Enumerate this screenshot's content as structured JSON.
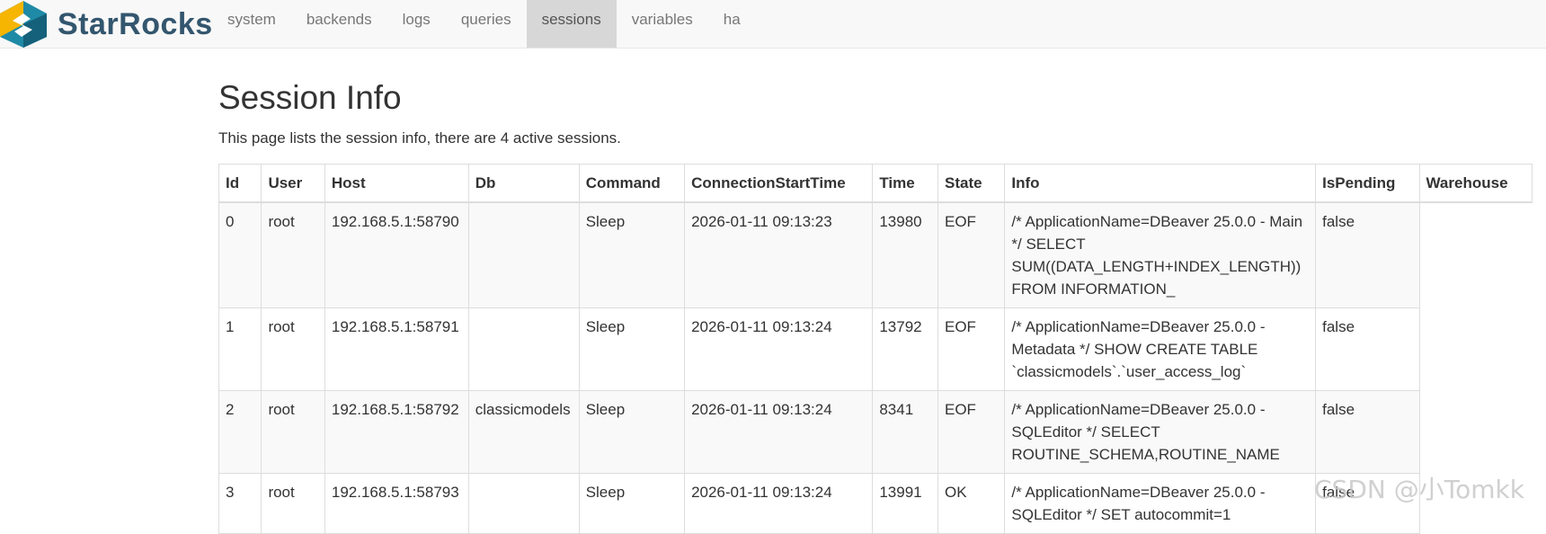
{
  "brand": {
    "name": "StarRocks"
  },
  "nav": {
    "items": [
      {
        "label": "system"
      },
      {
        "label": "backends"
      },
      {
        "label": "logs"
      },
      {
        "label": "queries"
      },
      {
        "label": "sessions"
      },
      {
        "label": "variables"
      },
      {
        "label": "ha"
      }
    ],
    "active_index": 4
  },
  "page": {
    "title": "Session Info",
    "description": "This page lists the session info, there are 4 active sessions."
  },
  "table": {
    "columns": [
      "Id",
      "User",
      "Host",
      "Db",
      "Command",
      "ConnectionStartTime",
      "Time",
      "State",
      "Info",
      "IsPending",
      "Warehouse"
    ],
    "rows": [
      [
        "0",
        "root",
        "192.168.5.1:58790",
        "",
        "Sleep",
        "2026-01-11 09:13:23",
        "13980",
        "EOF",
        "/* ApplicationName=DBeaver 25.0.0 - Main */ SELECT SUM((DATA_LENGTH+INDEX_LENGTH)) FROM INFORMATION_",
        "false",
        ""
      ],
      [
        "1",
        "root",
        "192.168.5.1:58791",
        "",
        "Sleep",
        "2026-01-11 09:13:24",
        "13792",
        "EOF",
        "/* ApplicationName=DBeaver 25.0.0 - Metadata */ SHOW CREATE TABLE `classicmodels`.`user_access_log`",
        "false",
        ""
      ],
      [
        "2",
        "root",
        "192.168.5.1:58792",
        "classicmodels",
        "Sleep",
        "2026-01-11 09:13:24",
        "8341",
        "EOF",
        "/* ApplicationName=DBeaver 25.0.0 - SQLEditor */ SELECT ROUTINE_SCHEMA,ROUTINE_NAME",
        "false",
        ""
      ],
      [
        "3",
        "root",
        "192.168.5.1:58793",
        "",
        "Sleep",
        "2026-01-11 09:13:24",
        "13991",
        "OK",
        "/* ApplicationName=DBeaver 25.0.0 - SQLEditor */ SET autocommit=1",
        "false",
        ""
      ]
    ]
  },
  "watermark": "CSDN @小Tomkk",
  "colors": {
    "brand_text": "#33566e",
    "logo_yellow": "#f5b500",
    "logo_teal": "#1f8aa6",
    "active_tab_bg": "#d7d7d7"
  }
}
